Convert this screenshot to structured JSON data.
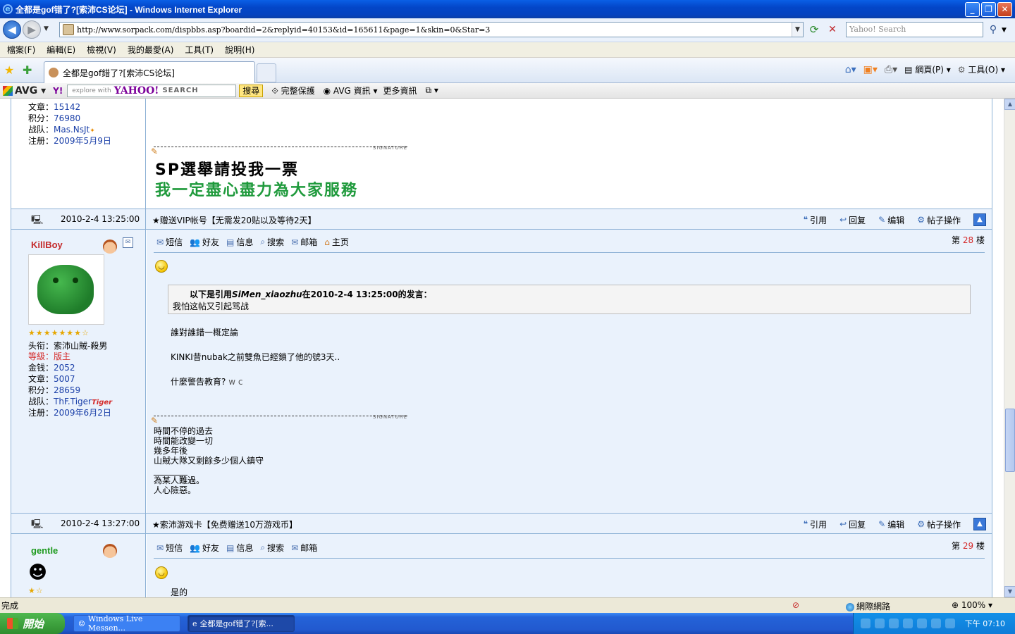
{
  "window": {
    "title": "全都是gof错了?[索沛CS论坛] - Windows Internet Explorer",
    "minimize": "_",
    "maximize": "❐",
    "close": "✕"
  },
  "address": {
    "url": "http://www.sorpack.com/dispbbs.asp?boardid=2&replyid=40153&id=165611&page=1&skin=0&Star=3",
    "search_placeholder": "Yahoo! Search"
  },
  "menu": [
    "檔案(F)",
    "編輯(E)",
    "檢視(V)",
    "我的最愛(A)",
    "工具(T)",
    "說明(H)"
  ],
  "tab": {
    "label": "全都是gof錯了?[索沛CS论坛]"
  },
  "commandbar": {
    "page": "網頁(P)",
    "tools": "工具(O)"
  },
  "avgbar": {
    "logo": "AVG",
    "yahoo": "Y!",
    "search_hint": "explore with",
    "brand": "YAHOO!",
    "search_word": "SEARCH",
    "search_button": "搜尋",
    "protect": "完整保護",
    "avg_info": "AVG 資訊",
    "more_info": "更多資訊"
  },
  "post1": {
    "meta": [
      {
        "label": "文章：",
        "value": "15142"
      },
      {
        "label": "积分：",
        "value": "76980"
      },
      {
        "label": "战队：",
        "value": "Mas.NsJt"
      },
      {
        "label": "注册：",
        "value": "2009年5月9日"
      }
    ],
    "signature_label": "SIGNATURE",
    "sig_line1": "SP選舉請投我一票",
    "sig_line2": "我一定盡心盡力為大家服務"
  },
  "header2": {
    "time": "2010-2-4 13:25:00",
    "title": "★赠送VIP帐号【无需发20贴以及等待2天】"
  },
  "actions": [
    "引用",
    "回复",
    "编辑",
    "帖子操作"
  ],
  "post2": {
    "username": "KillBoy",
    "meta": [
      {
        "label": "头衔：",
        "value": "索沛山賊-殺男",
        "red": false
      },
      {
        "label": "等級：",
        "value": "版主",
        "red": true
      },
      {
        "label": "金钱：",
        "value": "2052",
        "red": false
      },
      {
        "label": "文章：",
        "value": "5007",
        "red": false
      },
      {
        "label": "积分：",
        "value": "28659",
        "red": false
      },
      {
        "label": "战队：",
        "value": "ThF.Tiger",
        "red": false
      },
      {
        "label": "注册：",
        "value": "2009年6月2日",
        "red": false
      }
    ],
    "team_badge": "Tiger",
    "stars": "★★★★★★★☆",
    "toolbar": [
      "短信",
      "好友",
      "信息",
      "搜索",
      "邮箱",
      "主页"
    ],
    "floor_prefix": "第",
    "floor_number": "28",
    "floor_suffix": "楼",
    "quote_prefix": "以下是引用",
    "quote_name": "SiMen_xiaozhu",
    "quote_suffix": "在2010-2-4 13:25:00的发言：",
    "quote_body": "我怕这帖又引起骂战",
    "lines": [
      "誰對誰錯一概定論",
      "KINKI昔nubak之前雙魚已經鎖了他的號3天..",
      "什麼警告教育?"
    ],
    "line3_tail": "w c",
    "signature_label": "SIGNATURE",
    "signature": "時間不停的過去\n時間能改變一切\n幾多年後\n山賊大隊又剩餘多少個人鎮守\n________\n為某人難過。\n人心險惡。"
  },
  "header3": {
    "time": "2010-2-4 13:27:00",
    "title": "★索沛游戏卡【免费赠送10万游戏币】"
  },
  "post3": {
    "username": "gentle",
    "stars": "★☆",
    "toolbar": [
      "短信",
      "好友",
      "信息",
      "搜索",
      "邮箱"
    ],
    "floor_prefix": "第",
    "floor_number": "29",
    "floor_suffix": "楼",
    "first_line": "是的"
  },
  "status": {
    "text": "完成",
    "zone": "網際網路",
    "zoom": "100%"
  },
  "taskbar": {
    "start": "開始",
    "task1": "Windows Live Messen...",
    "task2": "全都是gof错了?[索...",
    "clock": "下午 07:10"
  }
}
